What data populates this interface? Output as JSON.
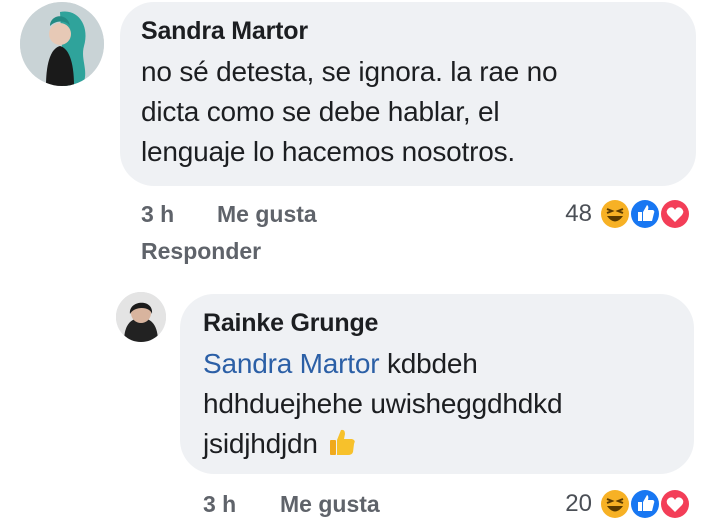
{
  "comment": {
    "author": "Sandra Martor",
    "lines": [
      "no sé detesta, se ignora. la rae no",
      "dicta como se debe hablar, el",
      "lenguaje lo hacemos nosotros."
    ],
    "time": "3 h",
    "like_label": "Me gusta",
    "reply_label": "Responder",
    "reaction_count": "48",
    "reactions": [
      "haha-icon",
      "like-icon",
      "love-icon"
    ]
  },
  "reply": {
    "author": "Rainke Grunge",
    "mention": "Sandra Martor",
    "lines": [
      "kdbdeh",
      "hdhduejhehe uwisheggdhdkd",
      "jsidjhdjdn"
    ],
    "emoji": "thumbs-up-icon",
    "time": "3 h",
    "like_label": "Me gusta",
    "reaction_count": "20",
    "reactions": [
      "haha-icon",
      "like-icon",
      "love-icon"
    ]
  },
  "colors": {
    "bubble": "#eff1f4",
    "mention": "#2b5fa6",
    "like_blue": "#1877f2",
    "love_red": "#f33e58",
    "haha_yellow": "#f7b125"
  }
}
